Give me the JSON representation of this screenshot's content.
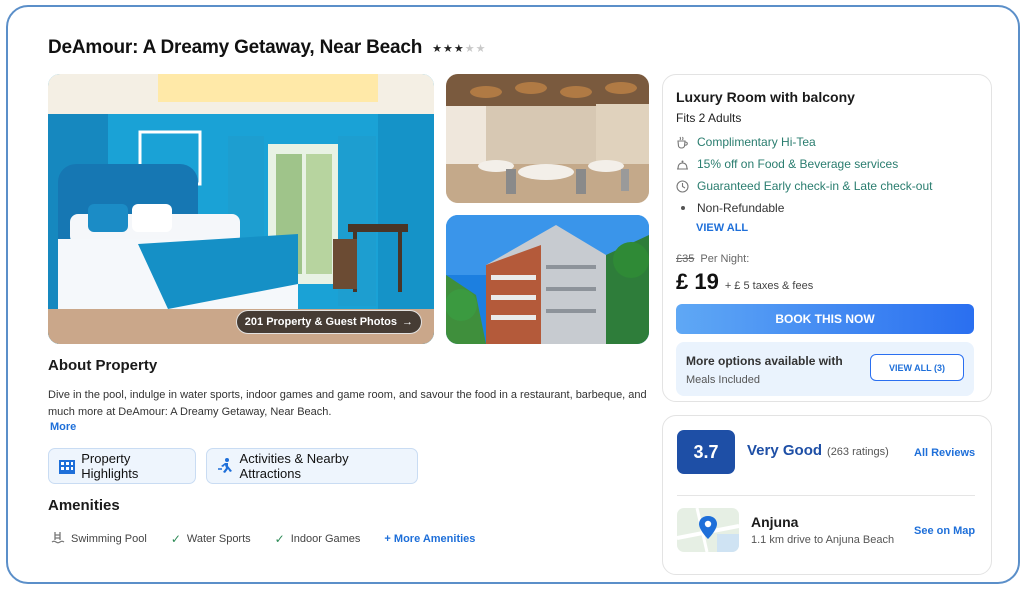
{
  "header": {
    "title": "DeAmour: A Dreamy Getaway, Near Beach",
    "stars_filled": 3,
    "stars_total": 5
  },
  "gallery": {
    "photos_button": "201 Property & Guest Photos",
    "photos_button_icon": "arrow-right-icon"
  },
  "about": {
    "heading": "About Property",
    "text": "Dive in the pool, indulge in water sports, indoor games and game room, and savour the food in a restaurant, barbeque, and much more at DeAmour: A Dreamy Getaway, Near Beach.",
    "more": "More"
  },
  "chips": [
    {
      "label": "Property Highlights",
      "icon": "building-icon"
    },
    {
      "label": "Activities & Nearby Attractions",
      "icon": "running-person-icon"
    }
  ],
  "amenities": {
    "heading": "Amenities",
    "items": [
      {
        "label": "Swimming Pool",
        "icon": "pool-icon"
      },
      {
        "label": "Water Sports",
        "icon": "check-icon"
      },
      {
        "label": "Indoor Games",
        "icon": "check-icon"
      }
    ],
    "more": "+ More Amenities"
  },
  "room": {
    "title": "Luxury Room with balcony",
    "fits": "Fits 2 Adults",
    "perks": [
      {
        "label": "Complimentary Hi-Tea",
        "icon": "tea-cup-icon"
      },
      {
        "label": "15% off on Food & Beverage services",
        "icon": "food-icon"
      },
      {
        "label": "Guaranteed Early check-in & Late check-out",
        "icon": "clock-icon"
      },
      {
        "label": "Non-Refundable",
        "icon": "bullet-icon"
      }
    ],
    "view_all": "VIEW ALL",
    "old_price": "£35",
    "per_night": "Per Night:",
    "price": "£ 19",
    "taxes": "+ £ 5 taxes & fees",
    "book_button": "BOOK THIS NOW",
    "options_title": "More options available with",
    "options_sub": "Meals Included",
    "options_button": "VIEW ALL (3)"
  },
  "reviews": {
    "score": "3.7",
    "label": "Very Good",
    "count": "(263 ratings)",
    "all_reviews": "All Reviews"
  },
  "location": {
    "name": "Anjuna",
    "sub": "1.1 km drive to Anjuna Beach",
    "see_map": "See on Map"
  },
  "colors": {
    "accent": "#1e6fd9",
    "score_bg": "#1e4fa6",
    "perk_text": "#2a7d6f",
    "frame_border": "#5b8fc9"
  }
}
